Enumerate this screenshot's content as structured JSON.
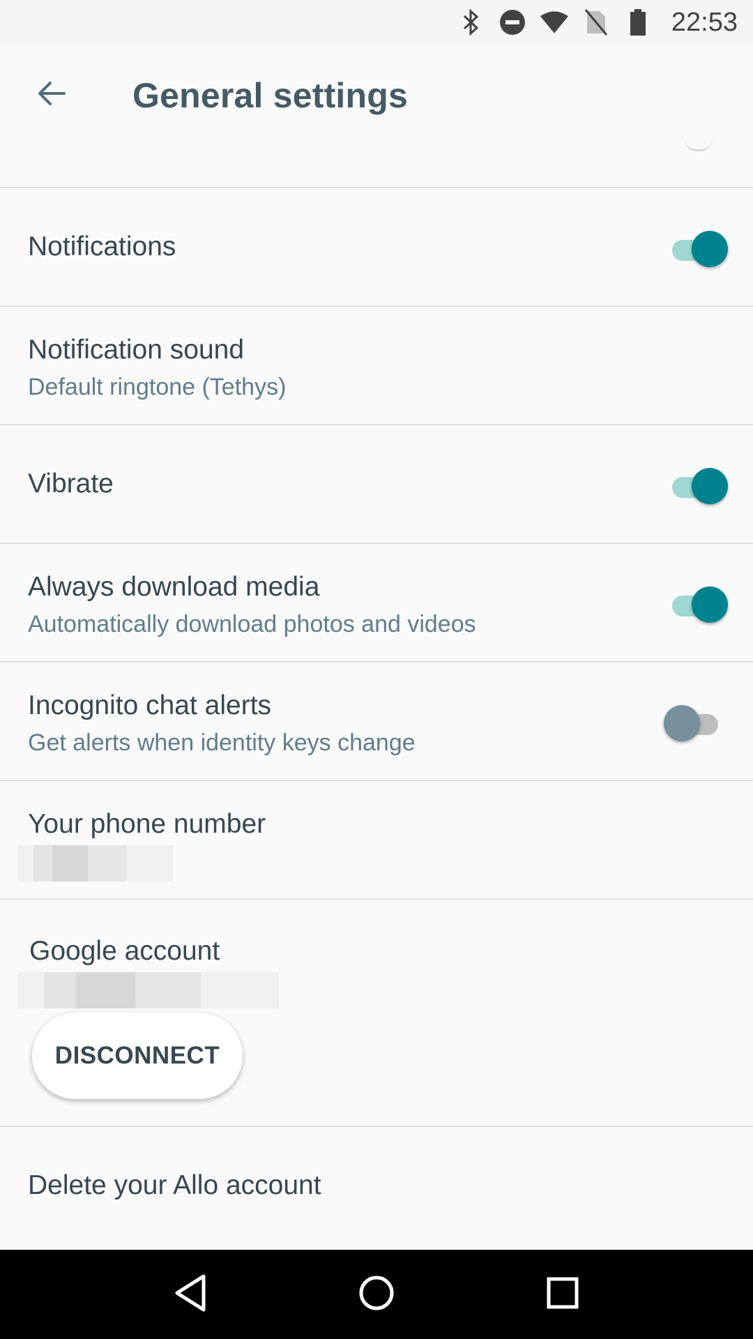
{
  "status_bar": {
    "time": "22:53",
    "icons": [
      "bluetooth-icon",
      "do-not-disturb-icon",
      "wifi-icon",
      "no-sim-icon",
      "battery-icon"
    ]
  },
  "toolbar": {
    "title": "General settings",
    "back_icon": "arrow-back-icon"
  },
  "settings": {
    "notifications": {
      "title": "Notifications",
      "enabled": true
    },
    "notification_sound": {
      "title": "Notification sound",
      "subtitle": "Default ringtone (Tethys)"
    },
    "vibrate": {
      "title": "Vibrate",
      "enabled": true
    },
    "always_download_media": {
      "title": "Always download media",
      "subtitle": "Automatically download photos and videos",
      "enabled": true
    },
    "incognito_chat_alerts": {
      "title": "Incognito chat alerts",
      "subtitle": "Get alerts when identity keys change",
      "enabled": false
    },
    "phone_number": {
      "title": "Your phone number"
    },
    "google_account": {
      "title": "Google account",
      "disconnect_label": "DISCONNECT"
    },
    "delete_account": {
      "title": "Delete your Allo account"
    }
  },
  "colors": {
    "accent": "#00838f",
    "accent_track": "#80cbc4",
    "off_thumb": "#78909c"
  },
  "nav_bar": {
    "icons": [
      "back-triangle-icon",
      "home-circle-icon",
      "recents-square-icon"
    ]
  }
}
